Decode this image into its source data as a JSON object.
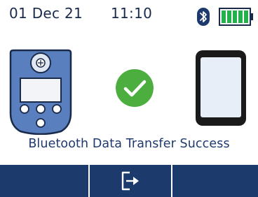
{
  "status": {
    "date": "01 Dec 21",
    "time": "11:10",
    "bluetooth_icon": "bluetooth-icon",
    "battery_icon": "battery-full-icon",
    "battery_level_fraction": 1.0
  },
  "graphic": {
    "source_icon": "detector-device-icon",
    "result_icon": "success-check-icon",
    "target_icon": "phone-icon"
  },
  "message": "Bluetooth Data Transfer Success",
  "softkeys": {
    "left_label": "",
    "center_icon": "exit-icon",
    "right_label": ""
  },
  "colors": {
    "navy": "#1c3a6b",
    "device_blue": "#5a7fbf",
    "success_green": "#4cae3f",
    "battery_green": "#22b14c"
  }
}
